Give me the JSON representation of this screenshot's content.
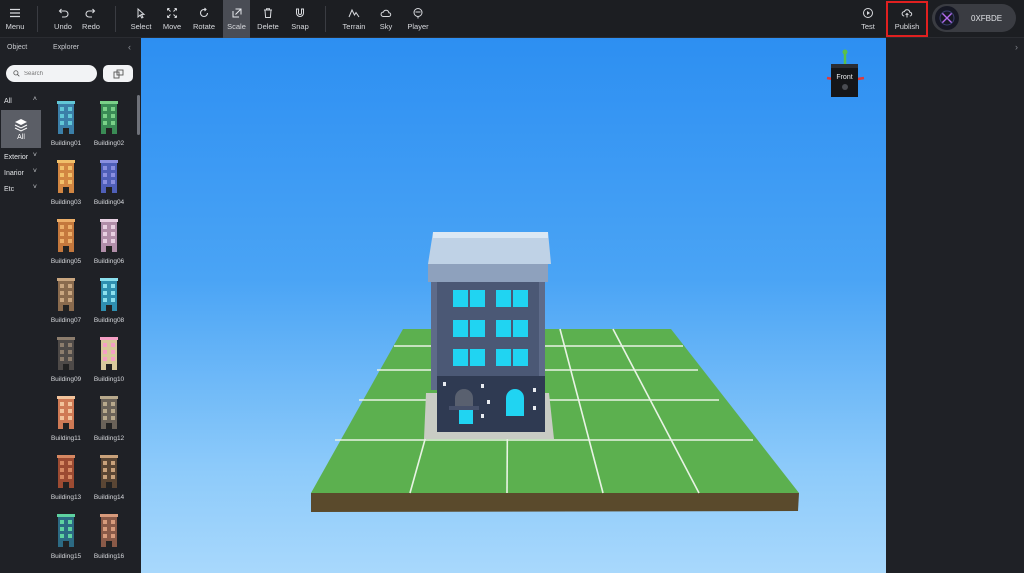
{
  "toolbar": {
    "menu": "Menu",
    "undo": "Undo",
    "redo": "Redo",
    "select": "Select",
    "move": "Move",
    "rotate": "Rotate",
    "scale": "Scale",
    "delete": "Delete",
    "snap": "Snap",
    "terrain": "Terrain",
    "sky": "Sky",
    "player": "Player",
    "test": "Test",
    "publish": "Publish"
  },
  "wallet": {
    "address": "0XFBDE"
  },
  "left_panel": {
    "tab_object": "Object",
    "tab_explorer": "Explorer",
    "search_placeholder": "Search",
    "categories": {
      "all": "All",
      "all_tile": "All",
      "exterior": "Exterior",
      "interior": "Inarior",
      "etc": "Etc"
    },
    "items": [
      "Building01",
      "Building02",
      "Building03",
      "Building04",
      "Building05",
      "Building06",
      "Building07",
      "Building08",
      "Building09",
      "Building10",
      "Building11",
      "Building12",
      "Building13",
      "Building14",
      "Building15",
      "Building16"
    ]
  },
  "viewport": {
    "gizmo_label": "Front"
  },
  "colors": {
    "toolbar_bg": "#1c1e22",
    "panel_bg": "#1f2126",
    "active_tool": "#4a4d55",
    "publish_highlight": "#e02020",
    "ground": "#5cb04f",
    "sky_top": "#2d8ff2",
    "sky_bottom": "#a8d8fc"
  }
}
